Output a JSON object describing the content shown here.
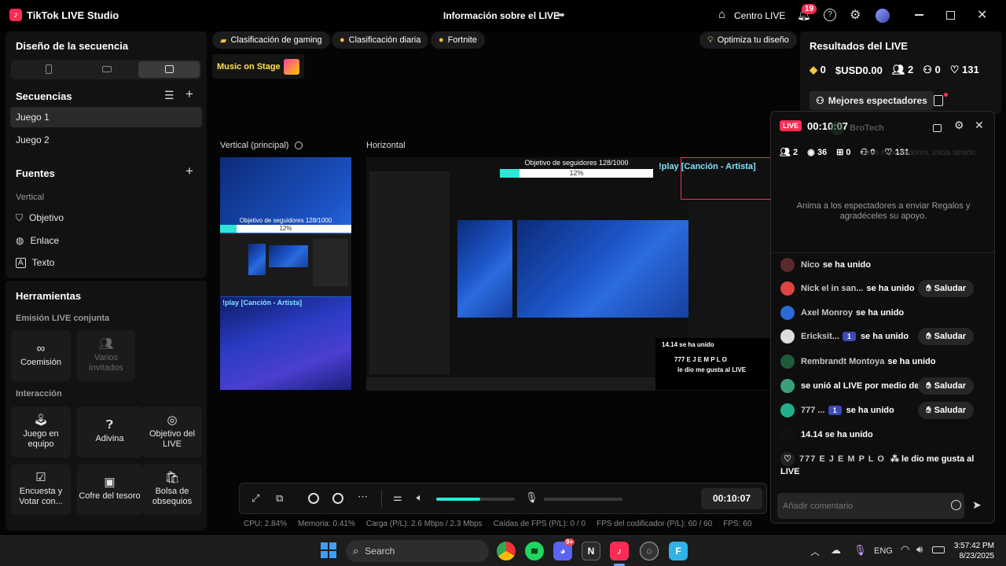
{
  "app": {
    "name": "TikTok LIVE Studio",
    "window_title": "Información sobre el LIVE",
    "centro_live": "Centro LIVE",
    "notif_count": "19"
  },
  "left": {
    "layout_title": "Diseño de la secuencia",
    "sequences_title": "Secuencias",
    "sequences": [
      "Juego 1",
      "Juego 2"
    ],
    "sources_title": "Fuentes",
    "sources_group": "Vertical",
    "sources": [
      {
        "icon": "shield-icon",
        "label": "Objetivo"
      },
      {
        "icon": "globe-icon",
        "label": "Enlace"
      },
      {
        "icon": "text-icon",
        "label": "Texto"
      }
    ],
    "tools_title": "Herramientas",
    "cohost_title": "Emisión LIVE conjunta",
    "cohost_tiles": [
      "Coemisión",
      "Varios invitados"
    ],
    "interaction_title": "Interacción",
    "interaction_tiles": [
      "Juego en equipo",
      "Adivina",
      "Objetivo del LIVE",
      "Encuesta y Votar con...",
      "Cofre del tesoro",
      "Bolsa de obsequios"
    ]
  },
  "center": {
    "chips": [
      "Clasificación de gaming",
      "Clasificación diaria",
      "Fortnite"
    ],
    "optimize": "Optimiza tu diseño",
    "music": "Music on Stage",
    "vertical_label": "Vertical (principal)",
    "horizontal_label": "Horizontal",
    "goal_text": "Objetivo de seguidores 128/1000",
    "goal_percent": "12%",
    "goal_progress": 0.128,
    "play_text": "!play [Canción - Artista]",
    "preview_events": [
      "14.14 se ha unido",
      "777 E J E M P L O",
      "le dio me gusta al LIVE"
    ],
    "timer": "00:10:07"
  },
  "status": {
    "cpu": "CPU: 2.84%",
    "mem": "Memoria: 0.41%",
    "load": "Carga (P/L): 2.6 Mbps / 2.3 Mbps",
    "drops": "Caídas de FPS (P/L): 0 / 0",
    "enc": "FPS del codificador (P/L): 60 / 60",
    "fps": "FPS: 60"
  },
  "right": {
    "results_title": "Resultados del LIVE",
    "stats": [
      "0",
      "USD0.00",
      "2",
      "0",
      "131"
    ],
    "best_viewers": "Mejores espectadores"
  },
  "overlay": {
    "live_badge": "LIVE",
    "time": "00:10:07",
    "ghost_user": "BroTech",
    "stats": [
      "2",
      "36",
      "0",
      "0",
      "131"
    ],
    "ghost_login": "Otros espectadores, inicia sesión",
    "hint": "Anima a los espectadores a enviar Regalos y agradéceles su apoyo.",
    "saludar": "Saludar",
    "chat": [
      {
        "name": "Nico",
        "text": "se ha unido",
        "badge": "",
        "btn": false,
        "color": "#5a2a2a"
      },
      {
        "name": "Nick el in san...",
        "text": "se ha unido",
        "badge": "",
        "btn": true,
        "color": "#d44"
      },
      {
        "name": "Axel Monroy",
        "text": "se ha unido",
        "badge": "",
        "btn": false,
        "color": "#2a6bd6"
      },
      {
        "name": "Ericksit...",
        "text": "se ha unido",
        "badge": "1",
        "btn": true,
        "color": "#ddd"
      },
      {
        "name": "Rembrandt Montoya",
        "text": "se ha unido",
        "badge": "",
        "btn": false,
        "color": "#1f5a3a"
      },
      {
        "name": "",
        "text": "se unió al LIVE por medio de",
        "badge": "",
        "btn": true,
        "color": "#3aa07a"
      },
      {
        "name": "777 ...",
        "text": "se ha unido",
        "badge": "1",
        "btn": true,
        "color": "#1fb08a"
      },
      {
        "name": "",
        "text": "14.14 se ha unido",
        "badge": "",
        "btn": false,
        "color": "#111"
      }
    ],
    "like_user": "777 E J E M P L O",
    "like_text": "le dio me gusta al LIVE",
    "comment_placeholder": "Añadir comentario"
  },
  "taskbar": {
    "search": "Search",
    "lang": "ENG",
    "time": "3:57:42 PM",
    "date": "8/23/2025",
    "discord_badge": "9+"
  }
}
